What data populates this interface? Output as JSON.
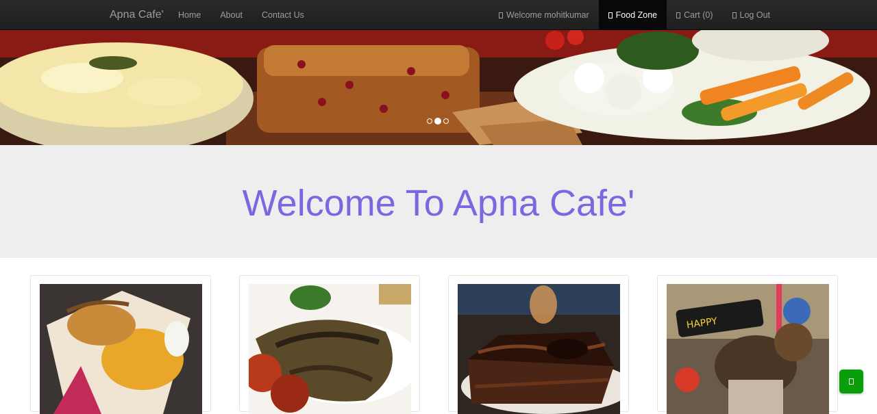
{
  "navbar": {
    "brand": "Apna Cafe'",
    "left_links": [
      "Home",
      "About",
      "Contact Us"
    ],
    "right_links": {
      "welcome": "Welcome mohitkumar",
      "food_zone": "Food Zone",
      "cart": "Cart (0)",
      "logout": "Log Out"
    },
    "colors": {
      "background": "#222222",
      "text": "#9d9d9d",
      "active_bg": "#080808",
      "active_text": "#ffffff"
    }
  },
  "carousel": {
    "slide_count": 3,
    "active_index": 1,
    "image": "food-spread-banner"
  },
  "jumbotron": {
    "title": "Welcome To Apna Cafe'",
    "title_color": "#7a68e0",
    "background": "#eeeeee"
  },
  "food_items": [
    {
      "image": "wrap-roll"
    },
    {
      "image": "grilled-fish"
    },
    {
      "image": "chocolate-cake"
    },
    {
      "image": "milkshake"
    }
  ],
  "floating_button": {
    "icon": "phone-icon",
    "color": "#0a9e0a"
  }
}
